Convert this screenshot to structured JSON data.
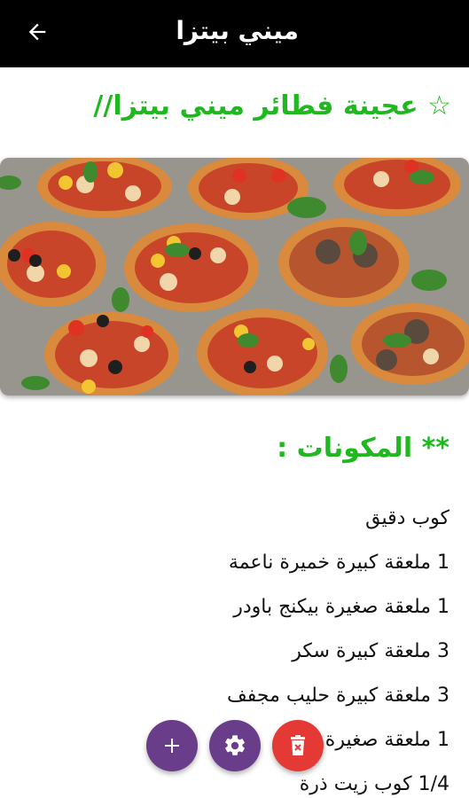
{
  "appbar": {
    "title": "ميني بيتزا",
    "back_icon": "arrow-back-icon"
  },
  "recipe": {
    "title": "☆ عجينة فطائر ميني بيتزا//",
    "image_icon": "mini-pizzas-photo",
    "ingredients_heading": "** المكونات :",
    "ingredients": [
      "كوب دقيق",
      "1 ملعقة كبيرة خميرة ناعمة",
      "1 ملعقة صغيرة بيكنج باودر",
      "3 ملعقة كبيرة سكر",
      "3 ملعقة كبيرة حليب مجفف",
      "1 ملعقة صغيرة ملح",
      "1/4 كوب زيت ذرة"
    ]
  },
  "fabs": {
    "add_icon": "plus-icon",
    "settings_icon": "gear-icon",
    "delete_icon": "delete-icon"
  },
  "colors": {
    "appbar": "#000000",
    "heading_green": "#1fb81f",
    "fab_purple": "#6a3d8a",
    "fab_red": "#e53935"
  }
}
